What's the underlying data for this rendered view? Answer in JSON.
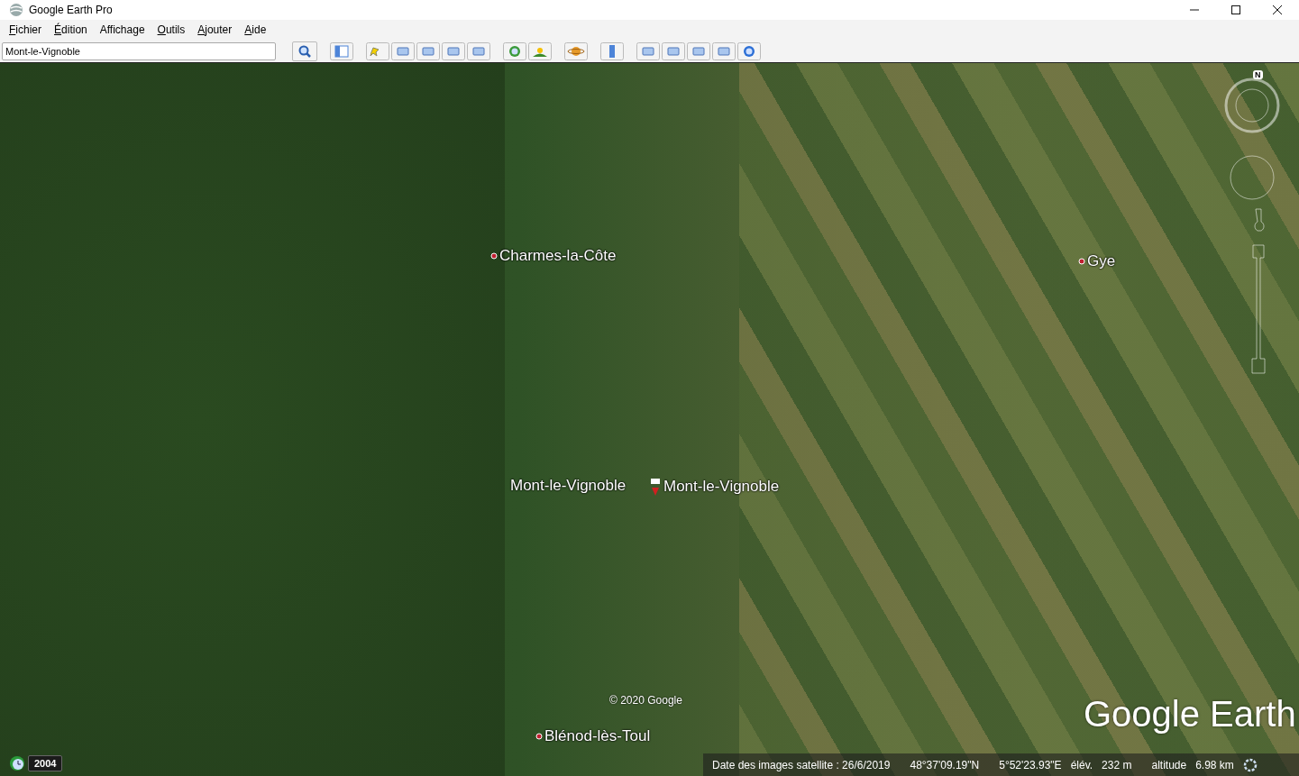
{
  "window": {
    "title": "Google Earth Pro"
  },
  "menu": [
    {
      "label": "Fichier",
      "mnemonic": true
    },
    {
      "label": "Édition",
      "mnemonic": true
    },
    {
      "label": "Affichage",
      "mnemonic": false
    },
    {
      "label": "Outils",
      "mnemonic": true
    },
    {
      "label": "Ajouter",
      "mnemonic": true
    },
    {
      "label": "Aide",
      "mnemonic": true
    }
  ],
  "search": {
    "value": "Mont-le-Vignoble"
  },
  "map": {
    "places": [
      {
        "kind": "pin",
        "name": "Charmes-la-Côte"
      },
      {
        "kind": "pin",
        "name": "Gye"
      },
      {
        "kind": "search-result",
        "name": "Mont-le-Vignoble"
      },
      {
        "kind": "search-result",
        "name": "Mont-le-Vignoble"
      },
      {
        "kind": "pin",
        "name": "Blénod-lès-Toul"
      }
    ],
    "copyright": "© 2020 Google",
    "logo": "Google Earth",
    "compass_letter": "N",
    "history_year": "2004"
  },
  "status_bar": {
    "imagery_date": "Date des images satellite : 26/6/2019",
    "latitude": "48°37'09.19\"N",
    "longitude": "5°52'23.93\"E",
    "elevation_label": "élév.",
    "elevation": "232 m",
    "altitude_label": "altitude",
    "altitude": "6.98 km"
  }
}
